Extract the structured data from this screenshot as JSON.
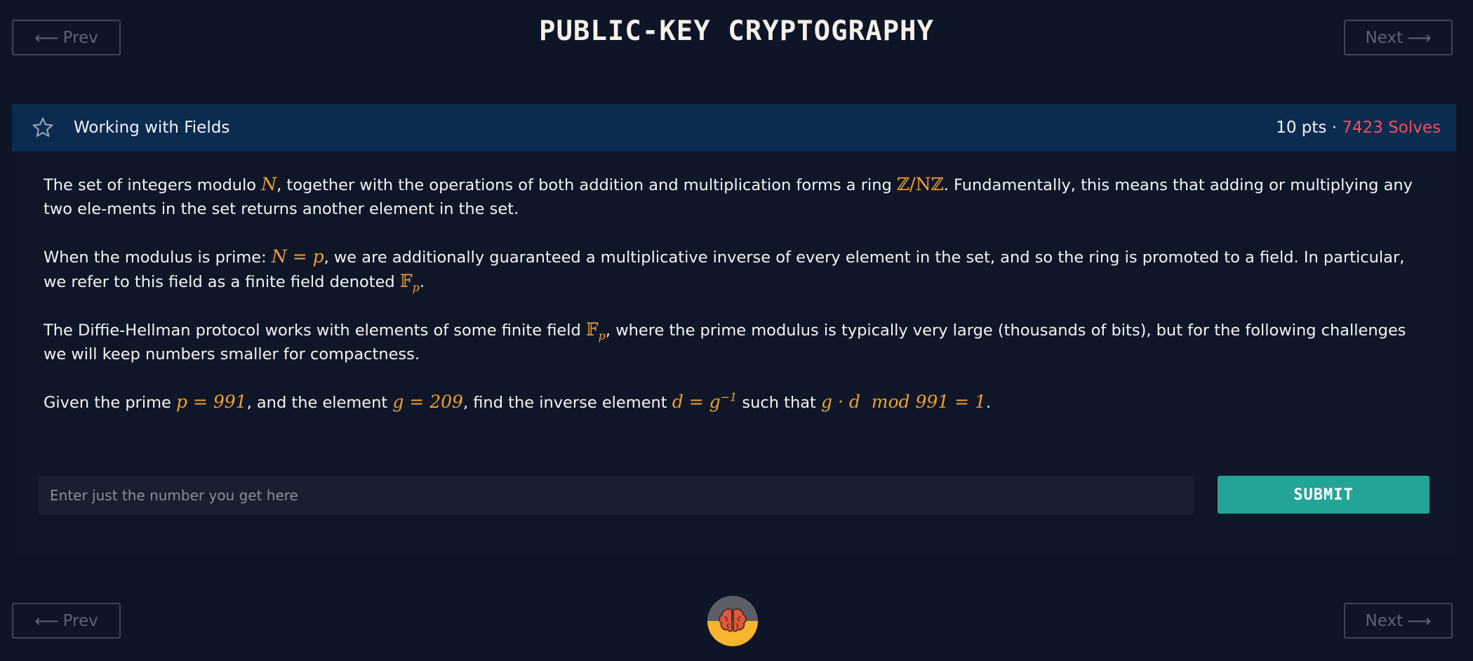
{
  "nav": {
    "prev_label": "Prev",
    "next_label": "Next",
    "prev_arrow": "⟵",
    "next_arrow": "⟶"
  },
  "page_title": "PUBLIC-KEY CRYPTOGRAPHY",
  "challenge": {
    "title": "Working with Fields",
    "points": "10 pts",
    "separator": " · ",
    "solves": "7423 Solves",
    "icon": "star-icon"
  },
  "paragraphs": {
    "p1": {
      "t1": "The set of integers modulo ",
      "m1": "N",
      "t2": ", together with the operations of both addition and multiplication forms a ring ",
      "m2": "ℤ/Nℤ",
      "t3": ". Fundamentally, this means that adding or multiplying any two ele-ments in the set returns another element in the set."
    },
    "p2": {
      "t1": "When the modulus is prime: ",
      "m1": "N = p",
      "t2": ", we are additionally guaranteed a multiplicative inverse of every element in the set, and so the ring is promoted to a field. In particular, we refer to this field as a finite field denoted ",
      "m2": "𝔽",
      "m2_sub": "p",
      "t3": "."
    },
    "p3": {
      "t1": "The Diffie-Hellman protocol works with elements of some finite field ",
      "m1": "𝔽",
      "m1_sub": "p",
      "t2": ", where the prime modulus is typically very large (thousands of bits), but for the following challenges we will keep numbers smaller for compactness."
    },
    "p4": {
      "t1": "Given the prime ",
      "m1": "p = 991",
      "t2": ", and the element ",
      "m2": "g = 209",
      "t3": ", find the inverse element ",
      "m3": "d = g",
      "m3_sup": "−1",
      "t4": " such that ",
      "m4": "g · d  mod 991 = 1",
      "t5": "."
    }
  },
  "answer": {
    "placeholder": "Enter just the number you get here",
    "value": "",
    "submit_label": "SUBMIT"
  },
  "colors": {
    "background": "#0d1526",
    "header": "#0b2c50",
    "math": "#f0a030",
    "solves": "#f0505c",
    "submit": "#24a496"
  },
  "logo": {
    "icon": "brain-logo-icon"
  }
}
